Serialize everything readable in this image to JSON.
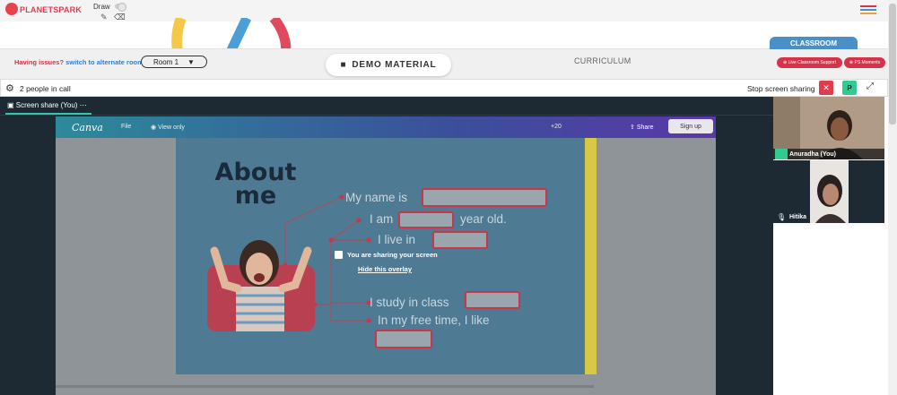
{
  "brand": {
    "logo_text": "PLANETSPARK"
  },
  "draw": {
    "label": "Draw"
  },
  "room_bar": {
    "issue_text": "Having issues?",
    "issue_link": "switch to alternate room",
    "room_select": "Room 1"
  },
  "tabs": {
    "demo": "DEMO MATERIAL",
    "curriculum": "CURRICULUM",
    "classroom": "CLASSROOM",
    "live_support": "Live Classroom Support",
    "ps_moments": "PS Moments"
  },
  "call": {
    "people_count": "2 people in call",
    "stop_sharing": "Stop screen sharing",
    "p_button": "P"
  },
  "share": {
    "tab_label": "Screen share (You)",
    "tab_menu": "⋯",
    "overlay_message": "You are sharing your screen",
    "overlay_hide": "Hide this overlay"
  },
  "canva": {
    "logo": "Canva",
    "file": "File",
    "view_only": "View only",
    "count": "+20",
    "share": "Share",
    "signup": "Sign up"
  },
  "slide": {
    "title": "About me",
    "lines": {
      "name": "My name is",
      "age_prefix": "I am",
      "age_suffix": "year old.",
      "live": "I live in",
      "study": "I study in class",
      "free_time": "In my free time, I like"
    }
  },
  "participants": [
    {
      "name": "Anuradha (You)"
    },
    {
      "name": "Hitika"
    }
  ],
  "colors": {
    "brand_red": "#d6334a",
    "link_blue": "#2d7fd1",
    "classroom_blue": "#4a90c8",
    "accent_green": "#2ecc8f",
    "slide_blue": "#4f7a93"
  }
}
